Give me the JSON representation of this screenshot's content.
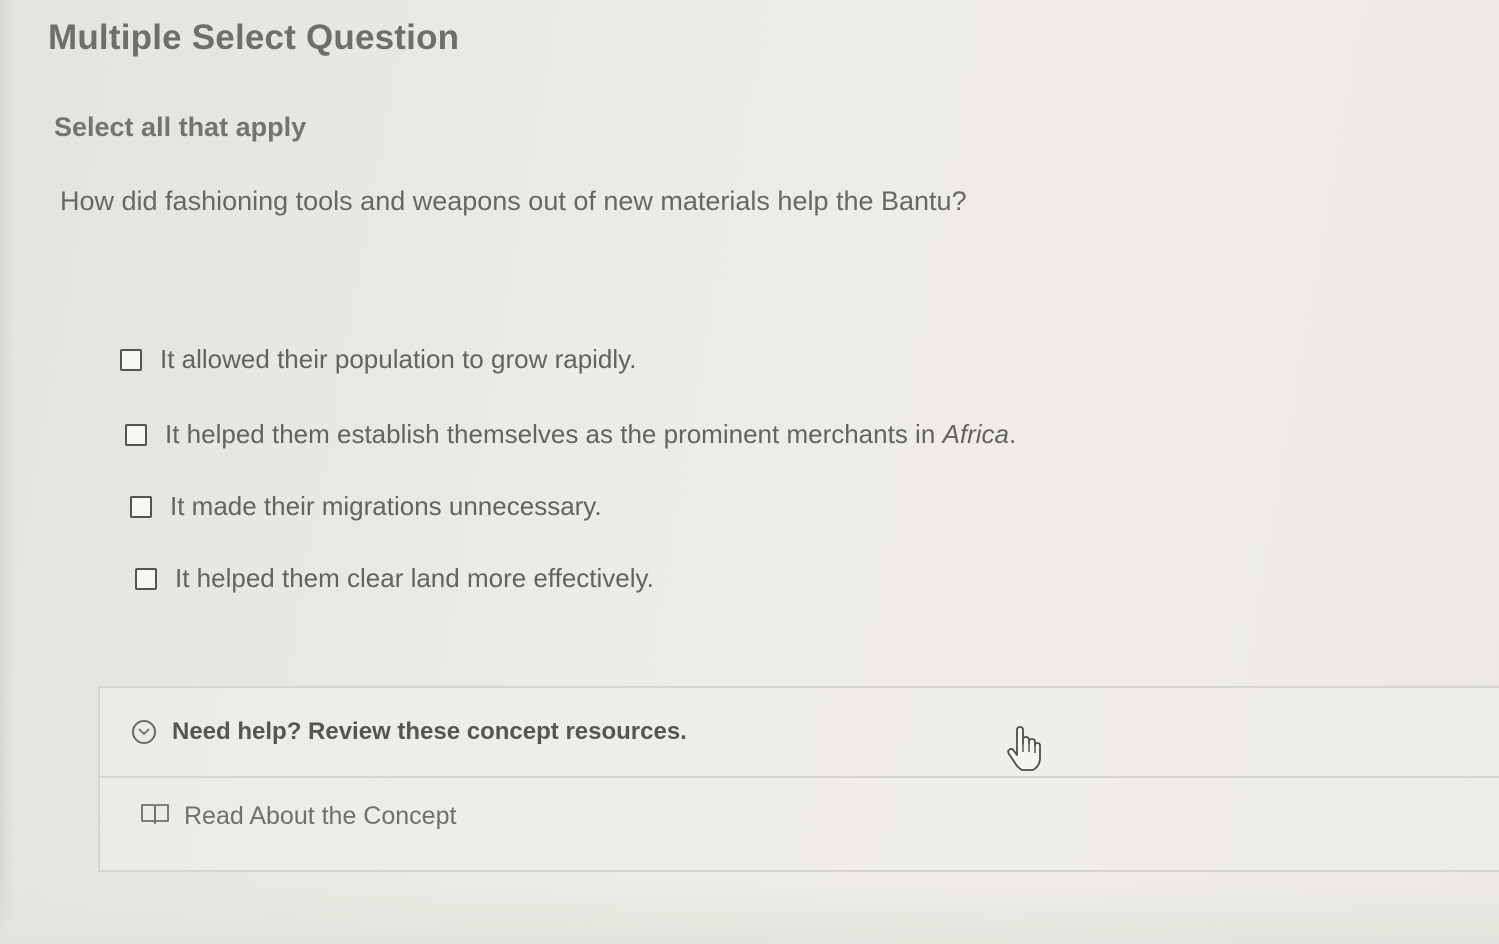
{
  "question": {
    "heading": "Multiple Select Question",
    "instruction": "Select all that apply",
    "prompt": "How did fashioning tools and weapons out of new materials help the Bantu?"
  },
  "options": [
    {
      "label": "It allowed their population to grow rapidly.",
      "checked": false
    },
    {
      "label_before": "It helped them establish themselves as the prominent merchants in ",
      "label_italic": "Africa",
      "label_after": ".",
      "checked": false
    },
    {
      "label": "It made their migrations unnecessary.",
      "checked": false
    },
    {
      "label": "It helped them clear land more effectively.",
      "checked": false
    }
  ],
  "help": {
    "title": "Need help? Review these concept resources.",
    "resource_label": "Read About the Concept",
    "toggle_icon": "chevron-down-circle-icon",
    "resource_icon": "book-icon"
  },
  "cursor_icon": "hand-pointer-icon"
}
